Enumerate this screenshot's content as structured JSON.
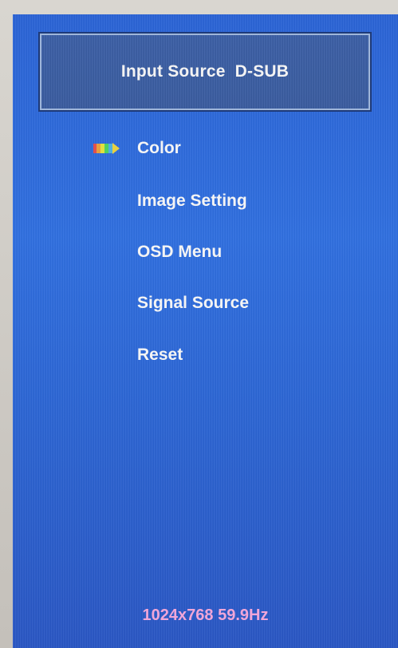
{
  "header": {
    "title": "Input Source  D-SUB"
  },
  "menu": {
    "items": [
      {
        "label": "Color",
        "selected": true
      },
      {
        "label": "Image Setting",
        "selected": false
      },
      {
        "label": "OSD Menu",
        "selected": false
      },
      {
        "label": "Signal Source",
        "selected": false
      },
      {
        "label": "Reset",
        "selected": false
      }
    ],
    "selector_icon": "color-bars-arrow-icon"
  },
  "footer": {
    "resolution": "1024x768 59.9Hz"
  },
  "colors": {
    "background": "#2f6fe0",
    "header_box": "#3a5ca0",
    "header_border": "#9fb6da",
    "text": "#f4f4f4",
    "footer_text": "#f0a6d8"
  }
}
